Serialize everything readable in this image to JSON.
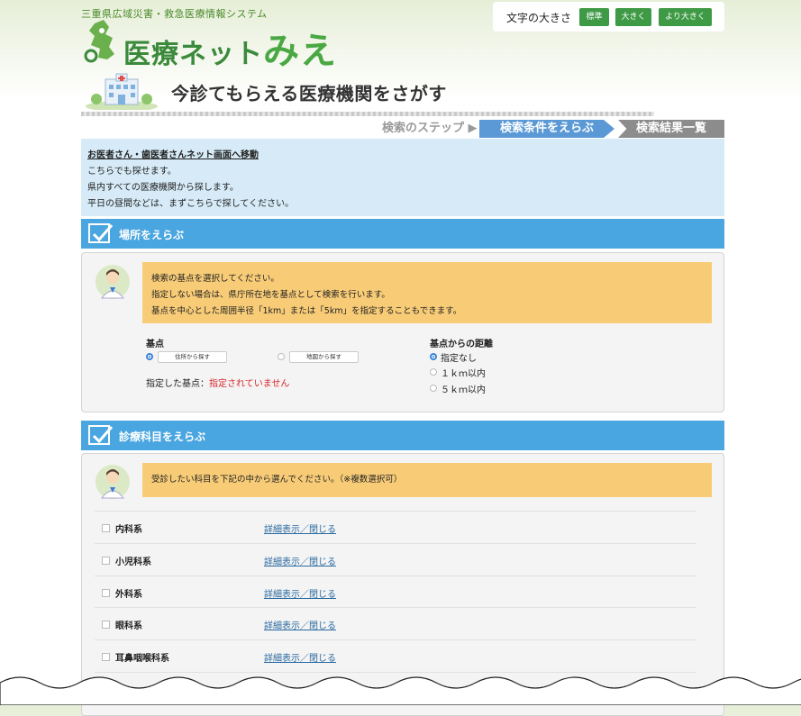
{
  "header": {
    "site_subtitle": "三重県広域災害・救急医療情報システム",
    "logo_text": "医療ネット",
    "logo_hira": "みえ",
    "font_size_label": "文字の大きさ",
    "font_buttons": [
      "標準",
      "大きく",
      "より大きく"
    ]
  },
  "page": {
    "title": "今診てもらえる医療機関をさがす"
  },
  "steps": {
    "label": "検索のステップ",
    "active": "検索条件をえらぶ",
    "next": "検索結果一覧"
  },
  "info": {
    "link": "お医者さん・歯医者さんネット画面へ移動",
    "lines": [
      "こちらでも探せます。",
      "県内すべての医療機関から探します。",
      "平日の昼間などは、まずこちらで探してください。"
    ]
  },
  "location": {
    "section_title": "場所をえらぶ",
    "bubble_lines": [
      "検索の基点を選択してください。",
      "指定しない場合は、県庁所在地を基点として検索を行います。",
      "基点を中心とした周囲半径「1km」または「5km」を指定することもできます。"
    ],
    "base_label": "基点",
    "base_options": [
      "住所から探す",
      "地図から探す"
    ],
    "selected_label": "指定した基点：",
    "selected_value": "指定されていません",
    "distance_label": "基点からの距離",
    "distance_options": [
      "指定なし",
      "１ｋｍ以内",
      "５ｋｍ以内"
    ]
  },
  "departments": {
    "section_title": "診療科目をえらぶ",
    "bubble_line": "受診したい科目を下記の中から選んでください。（※複数選択可）",
    "toggle_label": "詳細表示／閉じる",
    "items": [
      "内科系",
      "小児科系",
      "外科系",
      "眼科系",
      "耳鼻咽喉科系"
    ]
  },
  "colors": {
    "accent_blue": "#4aa6e0",
    "brand_green": "#3f9a45",
    "bubble": "#f8cc77",
    "alert_red": "#d8262c"
  }
}
